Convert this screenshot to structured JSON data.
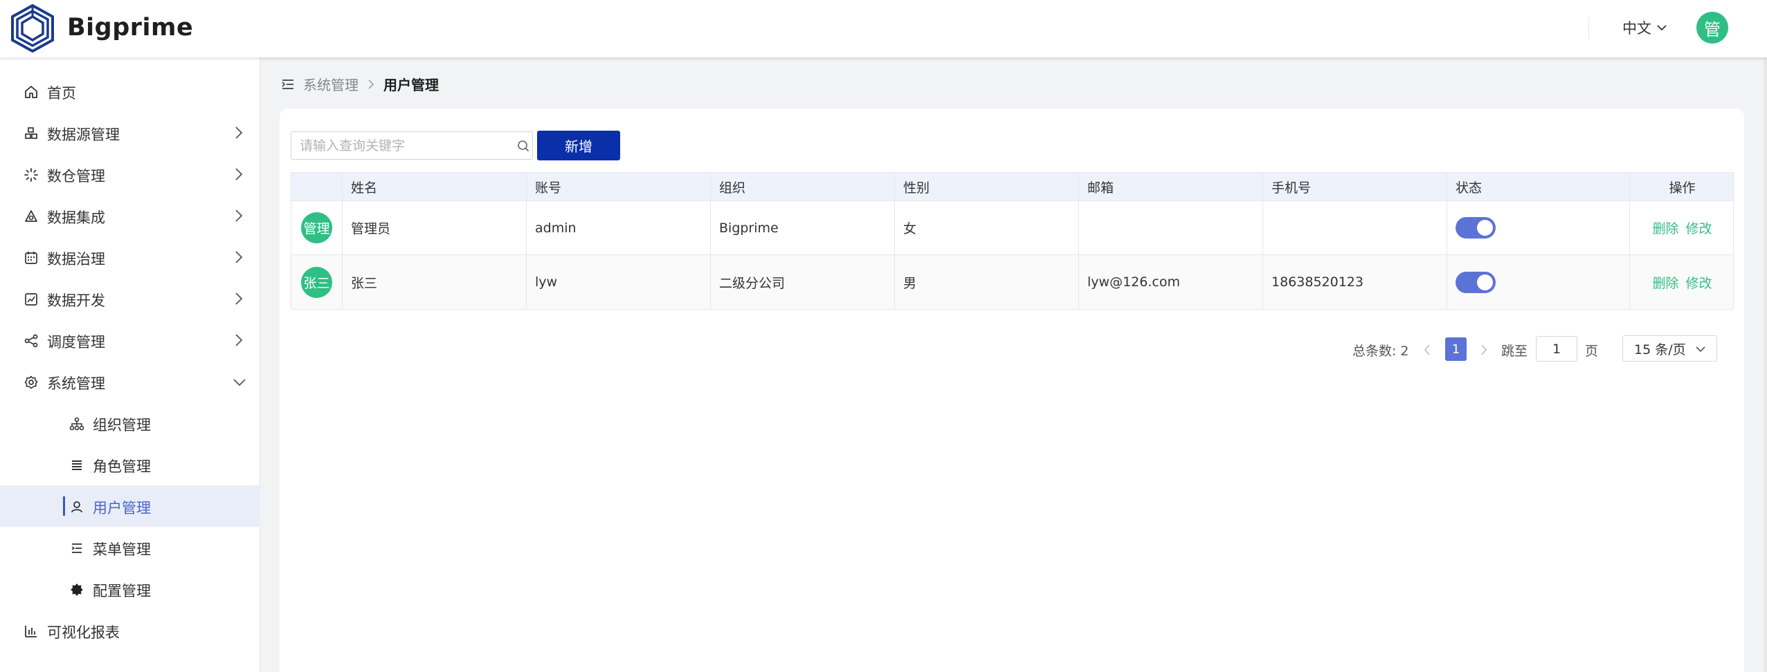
{
  "header": {
    "brand": "Bigprime",
    "language": "中文",
    "user_avatar_text": "管"
  },
  "sidebar": {
    "items": [
      {
        "label": "首页",
        "icon": "home-icon"
      },
      {
        "label": "数据源管理",
        "icon": "datasource-icon"
      },
      {
        "label": "数仓管理",
        "icon": "warehouse-icon"
      },
      {
        "label": "数据集成",
        "icon": "integration-icon"
      },
      {
        "label": "数据治理",
        "icon": "governance-icon"
      },
      {
        "label": "数据开发",
        "icon": "development-icon"
      },
      {
        "label": "调度管理",
        "icon": "schedule-icon"
      },
      {
        "label": "系统管理",
        "icon": "gear-icon"
      },
      {
        "label": "组织管理",
        "icon": "org-icon"
      },
      {
        "label": "角色管理",
        "icon": "list-icon"
      },
      {
        "label": "用户管理",
        "icon": "user-icon"
      },
      {
        "label": "菜单管理",
        "icon": "menu-icon"
      },
      {
        "label": "配置管理",
        "icon": "config-icon"
      },
      {
        "label": "可视化报表",
        "icon": "chart-icon"
      }
    ]
  },
  "breadcrumb": {
    "parent": "系统管理",
    "current": "用户管理"
  },
  "toolbar": {
    "search_placeholder": "请输入查询关键字",
    "add_label": "新增"
  },
  "table": {
    "columns": [
      "",
      "姓名",
      "账号",
      "组织",
      "性别",
      "邮箱",
      "手机号",
      "状态",
      "操作"
    ],
    "rows": [
      {
        "avatar": "管理",
        "name": "管理员",
        "account": "admin",
        "org": "Bigprime",
        "gender": "女",
        "email": "",
        "phone": "",
        "enabled": true,
        "delete": "删除",
        "edit": "修改"
      },
      {
        "avatar": "张三",
        "name": "张三",
        "account": "lyw",
        "org": "二级分公司",
        "gender": "男",
        "email": "lyw@126.com",
        "phone": "18638520123",
        "enabled": true,
        "delete": "删除",
        "edit": "修改"
      }
    ]
  },
  "pagination": {
    "total_label": "总条数:",
    "total": "2",
    "current_page": "1",
    "jump_label": "跳至",
    "jump_value": "1",
    "page_unit": "页",
    "page_size": "15 条/页"
  },
  "colors": {
    "primary_button": "#0a2fa8",
    "accent": "#5b72d6",
    "avatar": "#2fbf85",
    "link": "#2fbf85"
  }
}
